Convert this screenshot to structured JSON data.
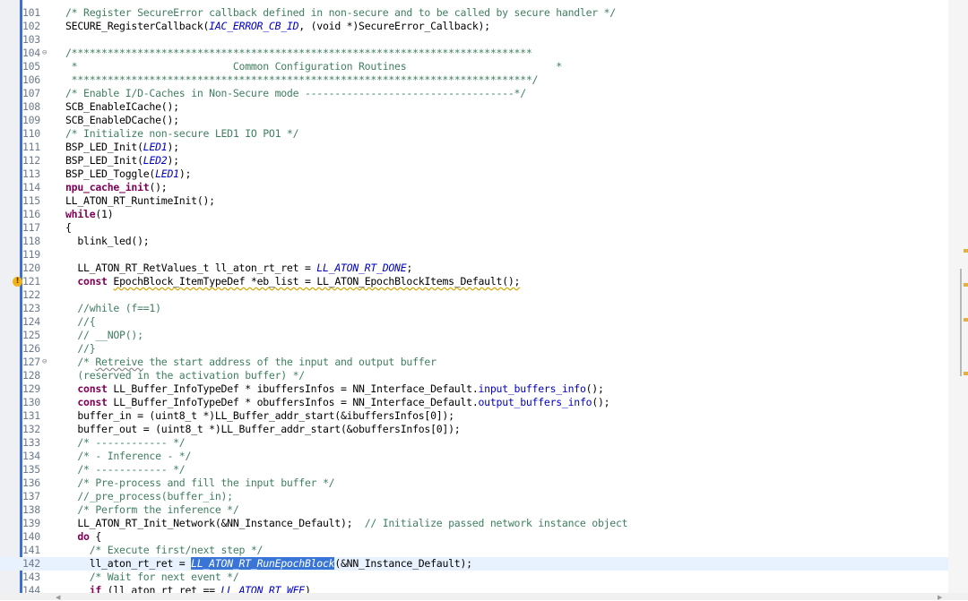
{
  "editor": {
    "lines": [
      {
        "n": "101",
        "fold": "",
        "warning": false,
        "current": false,
        "tokens": [
          {
            "t": "/* Register SecureError callback defined in non-secure and to be called by secure handler */",
            "k": "comment"
          }
        ]
      },
      {
        "n": "102",
        "fold": "",
        "warning": false,
        "current": false,
        "tokens": [
          {
            "t": "SECURE_RegisterCallback(",
            "k": "plain"
          },
          {
            "t": "IAC_ERROR_CB_ID",
            "k": "macro"
          },
          {
            "t": ", (void *)SecureError_Callback);",
            "k": "plain"
          }
        ]
      },
      {
        "n": "103",
        "fold": "",
        "warning": false,
        "current": false,
        "tokens": []
      },
      {
        "n": "104",
        "fold": "⊖",
        "warning": false,
        "current": false,
        "tokens": [
          {
            "t": "/*****************************************************************************",
            "k": "comment"
          }
        ]
      },
      {
        "n": "105",
        "fold": "",
        "warning": false,
        "current": false,
        "tokens": [
          {
            "t": " *                          Common Configuration Routines                         *",
            "k": "comment"
          }
        ]
      },
      {
        "n": "106",
        "fold": "",
        "warning": false,
        "current": false,
        "tokens": [
          {
            "t": " *****************************************************************************/",
            "k": "comment"
          }
        ]
      },
      {
        "n": "107",
        "fold": "",
        "warning": false,
        "current": false,
        "tokens": [
          {
            "t": "/* Enable I/D-Caches in Non-Secure mode -----------------------------------*/",
            "k": "comment"
          }
        ]
      },
      {
        "n": "108",
        "fold": "",
        "warning": false,
        "current": false,
        "tokens": [
          {
            "t": "SCB_EnableICache();",
            "k": "plain"
          }
        ]
      },
      {
        "n": "109",
        "fold": "",
        "warning": false,
        "current": false,
        "tokens": [
          {
            "t": "SCB_EnableDCache();",
            "k": "plain"
          }
        ]
      },
      {
        "n": "110",
        "fold": "",
        "warning": false,
        "current": false,
        "tokens": [
          {
            "t": "/* Initialize non-secure LED1 IO PO1 */",
            "k": "comment"
          }
        ]
      },
      {
        "n": "111",
        "fold": "",
        "warning": false,
        "current": false,
        "tokens": [
          {
            "t": "BSP_LED_Init(",
            "k": "plain"
          },
          {
            "t": "LED1",
            "k": "macro"
          },
          {
            "t": ");",
            "k": "plain"
          }
        ]
      },
      {
        "n": "112",
        "fold": "",
        "warning": false,
        "current": false,
        "tokens": [
          {
            "t": "BSP_LED_Init(",
            "k": "plain"
          },
          {
            "t": "LED2",
            "k": "macro"
          },
          {
            "t": ");",
            "k": "plain"
          }
        ]
      },
      {
        "n": "113",
        "fold": "",
        "warning": false,
        "current": false,
        "tokens": [
          {
            "t": "BSP_LED_Toggle(",
            "k": "plain"
          },
          {
            "t": "LED1",
            "k": "macro"
          },
          {
            "t": ");",
            "k": "plain"
          }
        ]
      },
      {
        "n": "114",
        "fold": "",
        "warning": false,
        "current": false,
        "tokens": [
          {
            "t": "npu_cache_init",
            "k": "kw"
          },
          {
            "t": "();",
            "k": "plain"
          }
        ]
      },
      {
        "n": "115",
        "fold": "",
        "warning": false,
        "current": false,
        "tokens": [
          {
            "t": "LL_ATON_RT_RuntimeInit();",
            "k": "plain"
          }
        ]
      },
      {
        "n": "116",
        "fold": "",
        "warning": false,
        "current": false,
        "tokens": [
          {
            "t": "while",
            "k": "kw"
          },
          {
            "t": "(1)",
            "k": "plain"
          }
        ]
      },
      {
        "n": "117",
        "fold": "",
        "warning": false,
        "current": false,
        "tokens": [
          {
            "t": "{",
            "k": "plain"
          }
        ]
      },
      {
        "n": "118",
        "fold": "",
        "warning": false,
        "current": false,
        "tokens": [
          {
            "t": "  blink_led();",
            "k": "plain"
          }
        ]
      },
      {
        "n": "119",
        "fold": "",
        "warning": false,
        "current": false,
        "tokens": []
      },
      {
        "n": "120",
        "fold": "",
        "warning": false,
        "current": false,
        "tokens": [
          {
            "t": "  LL_ATON_RT_RetValues_t ll_aton_rt_ret = ",
            "k": "plain"
          },
          {
            "t": "LL_ATON_RT_DONE",
            "k": "macro"
          },
          {
            "t": ";",
            "k": "plain"
          }
        ]
      },
      {
        "n": "121",
        "fold": "",
        "warning": true,
        "current": false,
        "tokens": [
          {
            "t": "  ",
            "k": "plain"
          },
          {
            "t": "const",
            "k": "kw"
          },
          {
            "t": " ",
            "k": "plain"
          },
          {
            "t": "EpochBlock_ItemTypeDef *eb_list = LL_ATON_EpochBlockItems_Default();",
            "k": "warnline"
          }
        ]
      },
      {
        "n": "122",
        "fold": "",
        "warning": false,
        "current": false,
        "tokens": []
      },
      {
        "n": "123",
        "fold": "",
        "warning": false,
        "current": false,
        "tokens": [
          {
            "t": "  //while (f==1)",
            "k": "comment"
          }
        ]
      },
      {
        "n": "124",
        "fold": "",
        "warning": false,
        "current": false,
        "tokens": [
          {
            "t": "  //{",
            "k": "comment"
          }
        ]
      },
      {
        "n": "125",
        "fold": "",
        "warning": false,
        "current": false,
        "tokens": [
          {
            "t": "  // __NOP();",
            "k": "comment"
          }
        ]
      },
      {
        "n": "126",
        "fold": "",
        "warning": false,
        "current": false,
        "tokens": [
          {
            "t": "  //}",
            "k": "comment"
          }
        ]
      },
      {
        "n": "127",
        "fold": "⊖",
        "warning": false,
        "current": false,
        "tokens": [
          {
            "t": "  /* ",
            "k": "comment"
          },
          {
            "t": "Retreive",
            "k": "commentspell"
          },
          {
            "t": " the start address of the input and output buffer",
            "k": "comment"
          }
        ]
      },
      {
        "n": "128",
        "fold": "",
        "warning": false,
        "current": false,
        "tokens": [
          {
            "t": "  (reserved in the activation buffer) */",
            "k": "comment"
          }
        ]
      },
      {
        "n": "129",
        "fold": "",
        "warning": false,
        "current": false,
        "tokens": [
          {
            "t": "  ",
            "k": "plain"
          },
          {
            "t": "const",
            "k": "kw"
          },
          {
            "t": " LL_Buffer_InfoTypeDef * ibuffersInfos = NN_Interface_Default.",
            "k": "plain"
          },
          {
            "t": "input_buffers_info",
            "k": "field"
          },
          {
            "t": "();",
            "k": "plain"
          }
        ]
      },
      {
        "n": "130",
        "fold": "",
        "warning": false,
        "current": false,
        "tokens": [
          {
            "t": "  ",
            "k": "plain"
          },
          {
            "t": "const",
            "k": "kw"
          },
          {
            "t": " LL_Buffer_InfoTypeDef * obuffersInfos = NN_Interface_Default.",
            "k": "plain"
          },
          {
            "t": "output_buffers_info",
            "k": "field"
          },
          {
            "t": "();",
            "k": "plain"
          }
        ]
      },
      {
        "n": "131",
        "fold": "",
        "warning": false,
        "current": false,
        "tokens": [
          {
            "t": "  buffer_in = (uint8_t *)LL_Buffer_addr_start(&ibuffersInfos[0]);",
            "k": "plain"
          }
        ]
      },
      {
        "n": "132",
        "fold": "",
        "warning": false,
        "current": false,
        "tokens": [
          {
            "t": "  buffer_out = (uint8_t *)LL_Buffer_addr_start(&obuffersInfos[0]);",
            "k": "plain"
          }
        ]
      },
      {
        "n": "133",
        "fold": "",
        "warning": false,
        "current": false,
        "tokens": [
          {
            "t": "  /* ------------ */",
            "k": "comment"
          }
        ]
      },
      {
        "n": "134",
        "fold": "",
        "warning": false,
        "current": false,
        "tokens": [
          {
            "t": "  /* - Inference - */",
            "k": "comment"
          }
        ]
      },
      {
        "n": "135",
        "fold": "",
        "warning": false,
        "current": false,
        "tokens": [
          {
            "t": "  /* ------------ */",
            "k": "comment"
          }
        ]
      },
      {
        "n": "136",
        "fold": "",
        "warning": false,
        "current": false,
        "tokens": [
          {
            "t": "  /* Pre-process and fill the input buffer */",
            "k": "comment"
          }
        ]
      },
      {
        "n": "137",
        "fold": "",
        "warning": false,
        "current": false,
        "tokens": [
          {
            "t": "  //_pre_process(buffer_in);",
            "k": "comment"
          }
        ]
      },
      {
        "n": "138",
        "fold": "",
        "warning": false,
        "current": false,
        "tokens": [
          {
            "t": "  /* Perform the inference */",
            "k": "comment"
          }
        ]
      },
      {
        "n": "139",
        "fold": "",
        "warning": false,
        "current": false,
        "tokens": [
          {
            "t": "  LL_ATON_RT_Init_Network(&NN_Instance_Default);  ",
            "k": "plain"
          },
          {
            "t": "// Initialize passed network instance object",
            "k": "comment"
          }
        ]
      },
      {
        "n": "140",
        "fold": "",
        "warning": false,
        "current": false,
        "tokens": [
          {
            "t": "  ",
            "k": "plain"
          },
          {
            "t": "do",
            "k": "kw"
          },
          {
            "t": " {",
            "k": "plain"
          }
        ]
      },
      {
        "n": "141",
        "fold": "",
        "warning": false,
        "current": false,
        "tokens": [
          {
            "t": "    /* Execute first/next step */",
            "k": "comment"
          }
        ]
      },
      {
        "n": "142",
        "fold": "",
        "warning": false,
        "current": true,
        "tokens": [
          {
            "t": "    ll_aton_rt_ret = ",
            "k": "plain"
          },
          {
            "t": "LL_ATON_RT_RunEpochBlock",
            "k": "selected"
          },
          {
            "t": "(&NN_Instance_Default);",
            "k": "plain"
          }
        ]
      },
      {
        "n": "143",
        "fold": "",
        "warning": false,
        "current": false,
        "tokens": [
          {
            "t": "    /* Wait for next event */",
            "k": "comment"
          }
        ]
      },
      {
        "n": "144",
        "fold": "",
        "warning": false,
        "current": false,
        "tokens": [
          {
            "t": "    ",
            "k": "plain"
          },
          {
            "t": "if",
            "k": "kw"
          },
          {
            "t": " (ll_aton_rt_ret == ",
            "k": "plain"
          },
          {
            "t": "LL_ATON_RT_WFE",
            "k": "macro"
          },
          {
            "t": ")",
            "k": "plain"
          }
        ]
      }
    ]
  },
  "scrollbar": {
    "overview_marks": [
      "warning",
      "warning",
      "warning",
      "warning"
    ]
  }
}
